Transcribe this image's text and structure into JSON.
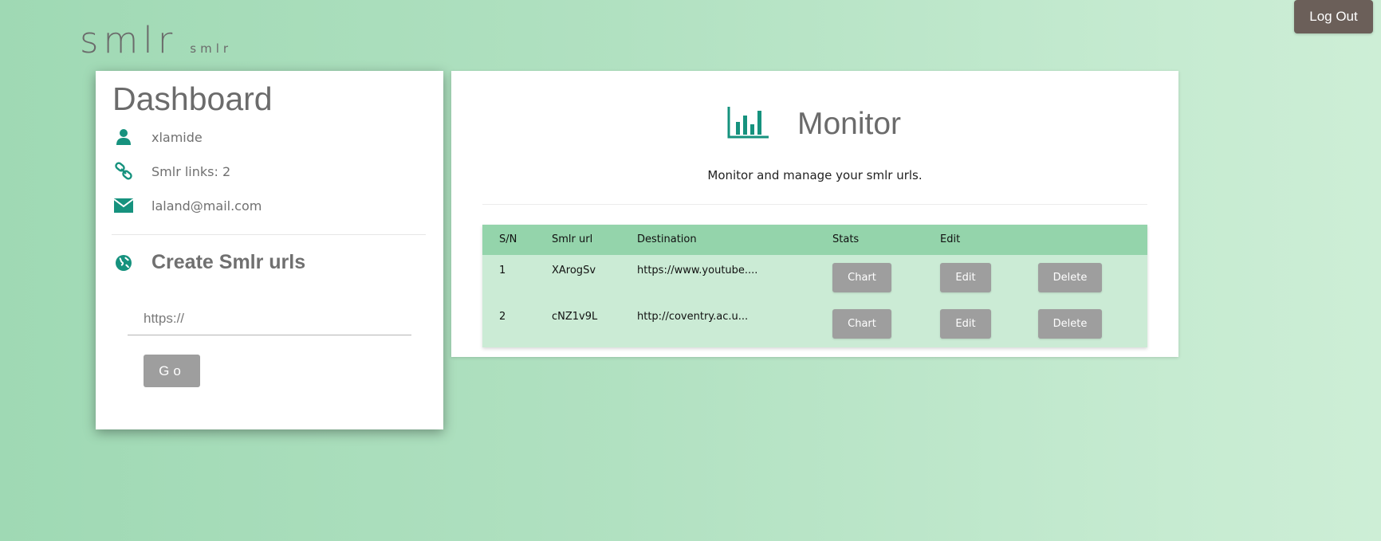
{
  "brand": {
    "main": "smlr",
    "sub": "smlr"
  },
  "header": {
    "logout_label": "Log Out"
  },
  "dashboard": {
    "title": "Dashboard",
    "username": "xlamide",
    "links_text": "Smlr links: 2",
    "email": "laland@mail.com",
    "create_title": "Create Smlr urls",
    "input_placeholder": "https://",
    "go_label": "Go",
    "icons": [
      "user-icon",
      "link-icon",
      "envelope-icon",
      "globe-icon"
    ]
  },
  "monitor": {
    "title": "Monitor",
    "subtitle": "Monitor and manage your smlr urls.",
    "icon": "bar-chart-icon",
    "columns": [
      "S/N",
      "Smlr url",
      "Destination",
      "Stats",
      "Edit"
    ],
    "rows": [
      {
        "sn": "1",
        "smlr": "XArogSv",
        "destination": "https://www.youtube....",
        "chart": "Chart",
        "edit": "Edit",
        "delete": "Delete"
      },
      {
        "sn": "2",
        "smlr": "cNZ1v9L",
        "destination": "http://coventry.ac.u...",
        "chart": "Chart",
        "edit": "Edit",
        "delete": "Delete"
      }
    ]
  },
  "colors": {
    "accent": "#16927e",
    "logout_bg": "#6b5f59",
    "button_gray": "#9e9e9e",
    "table_header": "#94d4ab",
    "table_body": "#cbebd5"
  }
}
